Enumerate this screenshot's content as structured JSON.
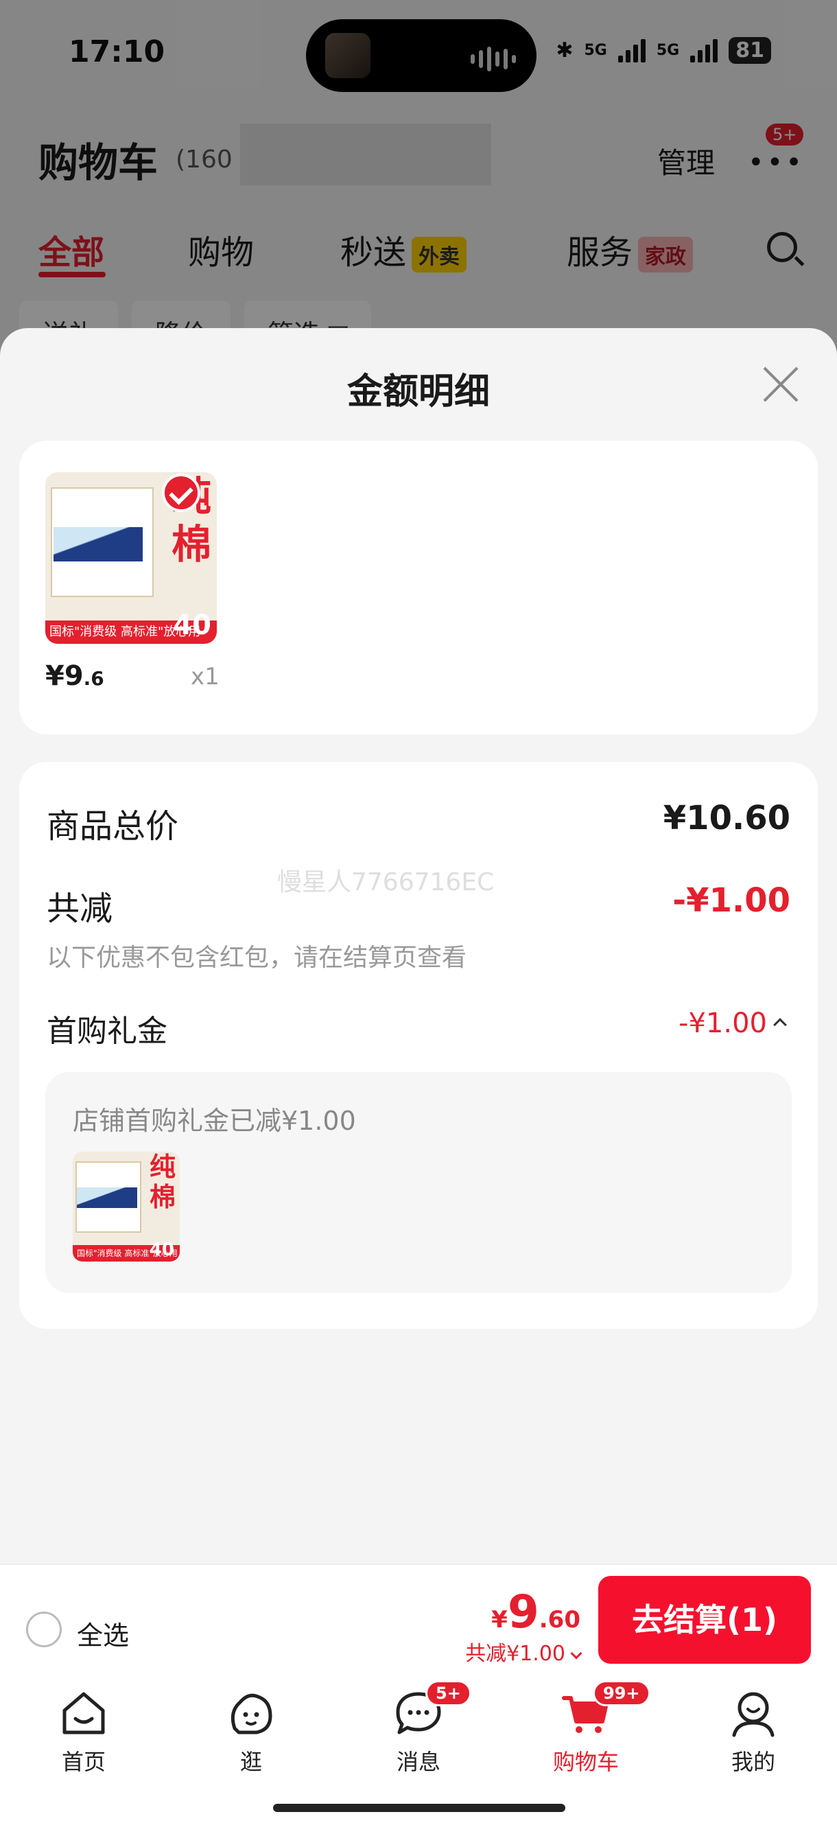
{
  "status_bar": {
    "time": "17:10",
    "net1": "5G",
    "net2": "5G",
    "battery": "81"
  },
  "header": {
    "title": "购物车",
    "count": "(160",
    "manage": "管理",
    "more_badge": "5+"
  },
  "tabs": [
    {
      "label": "全部"
    },
    {
      "label": "购物"
    },
    {
      "label": "秒送",
      "tag": "外卖"
    },
    {
      "label": "服务",
      "tag": "家政"
    }
  ],
  "chips": [
    "送礼",
    "降价",
    "筛选 ▽"
  ],
  "sheet": {
    "title": "金额明细",
    "product": {
      "price_int": "¥9",
      "price_dec": ".6",
      "qty": "x1",
      "thumb_text": "纯棉",
      "thumb_bottom": "国标\"消费级 高标准\"放心用",
      "thumb_num": "40"
    },
    "summary": {
      "total_label": "商品总价",
      "total_value": "¥10.60",
      "reduce_label": "共减",
      "reduce_value": "-¥1.00",
      "note": "以下优惠不包含红包，请在结算页查看",
      "first_label": "首购礼金",
      "first_value": "-¥1.00",
      "gift_text": "店铺首购礼金已减¥1.00"
    },
    "watermark": "慢星人7766716EC"
  },
  "checkout": {
    "select_all": "全选",
    "price_symbol": "¥",
    "price_int": "9",
    "price_dec": ".60",
    "discount": "共减¥1.00",
    "button": "去结算(1)"
  },
  "nav": [
    {
      "label": "首页",
      "icon": "home-icon"
    },
    {
      "label": "逛",
      "icon": "browse-icon"
    },
    {
      "label": "消息",
      "icon": "message-icon",
      "badge": "5+"
    },
    {
      "label": "购物车",
      "icon": "cart-icon",
      "badge": "99+"
    },
    {
      "label": "我的",
      "icon": "profile-icon"
    }
  ],
  "colors": {
    "accent": "#e4202e",
    "button": "#f5112e",
    "sheet_bg": "#f4f4f4"
  }
}
